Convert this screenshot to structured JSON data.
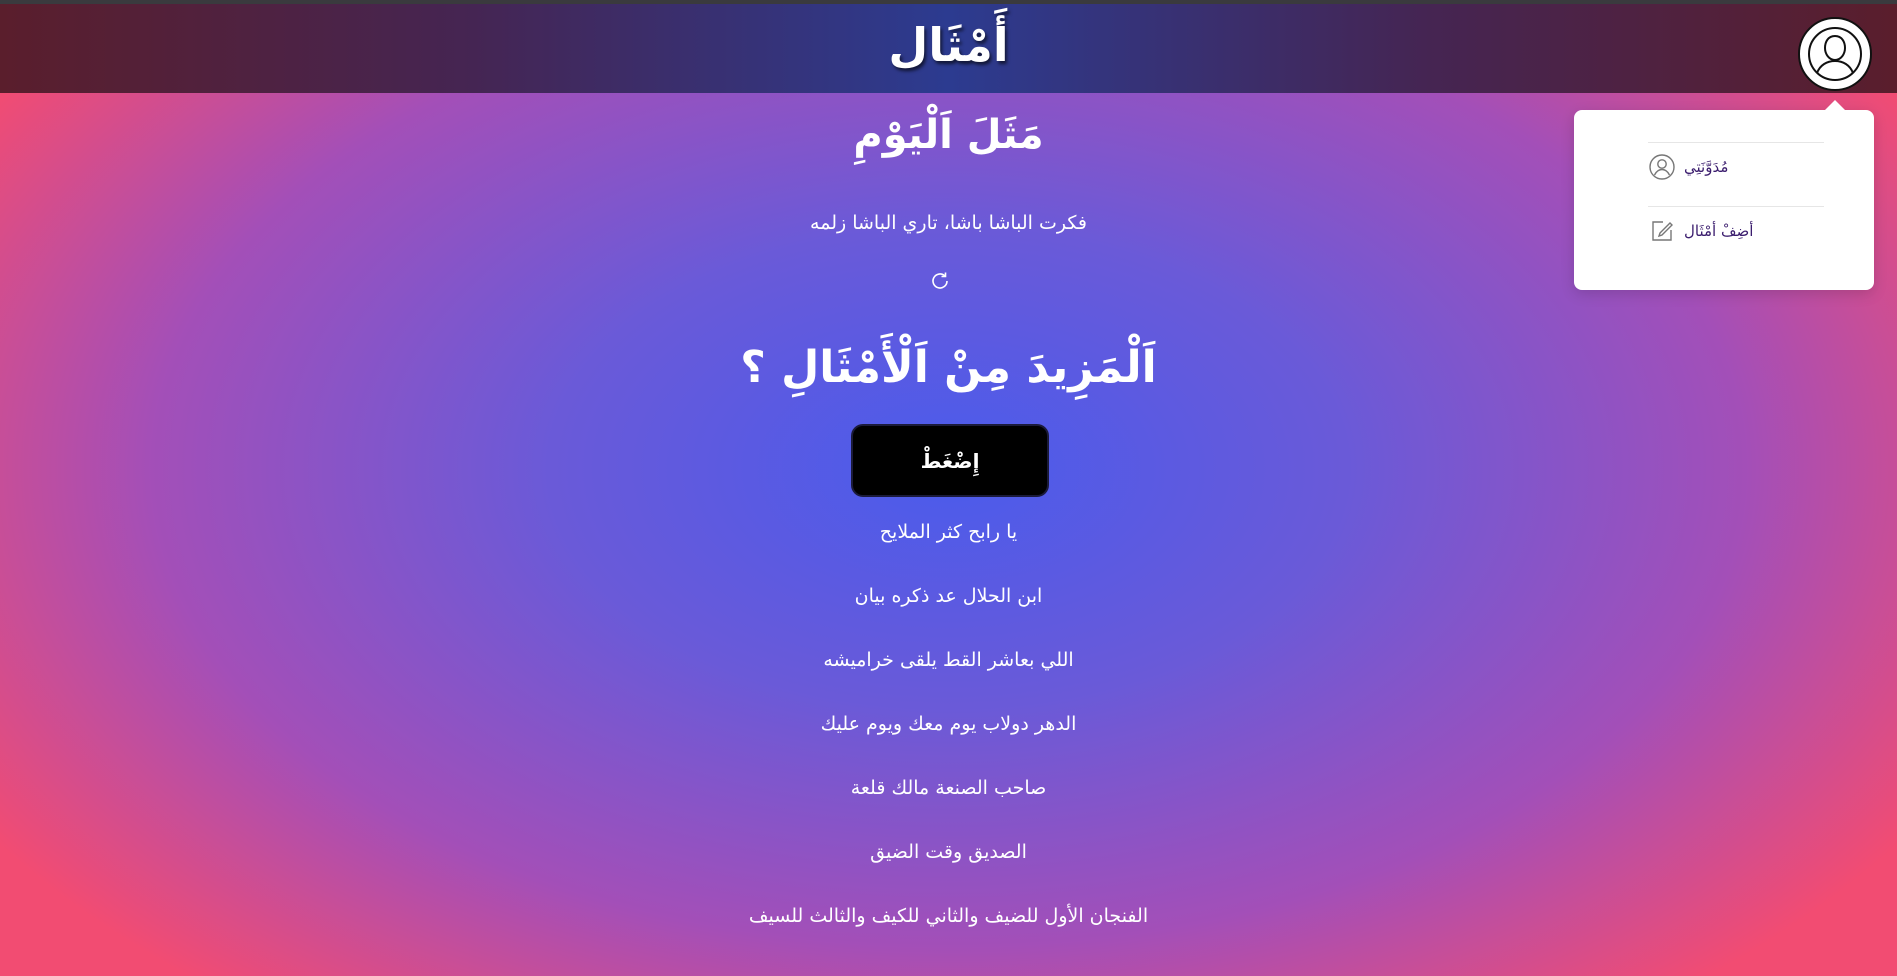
{
  "header": {
    "logo": "أَمْثَال",
    "avatar_icon": "user-avatar-icon"
  },
  "dropdown": {
    "items": [
      {
        "label": "مُدَوَّنَتِي",
        "icon": "user-circle-icon"
      },
      {
        "label": "أضِفْ أمْثَال",
        "icon": "edit-icon"
      }
    ]
  },
  "main": {
    "today_heading": "مَثَلَ اَلْيَوْمِ",
    "today_proverb": "فكرت الباشا باشا، تاري الباشا زلمه",
    "refresh_icon": "refresh-icon",
    "more_heading": "اَلْمَزِيدَ مِنْ اَلْأَمْثَالِ ؟",
    "press_button": "إِضْغَطْ",
    "proverbs": [
      "يا رابح كثر الملايح",
      "ابن الحلال عد ذكره بيان",
      "اللي بعاشر القط يلقى خراميشه",
      "الدهر دولاب يوم معك ويوم عليك",
      "صاحب الصنعة مالك قلعة",
      "الصديق وقت الضيق",
      "الفنجان الأول للضيف والثاني للكيف والثالث للسيف"
    ]
  },
  "colors": {
    "header_center": "#2c3b90",
    "header_edges": "#5a1e2c",
    "bg_center": "#4a5bec",
    "bg_edges": "#f24c72",
    "dropdown_text": "#3b1d6e",
    "button_bg": "#000000"
  }
}
